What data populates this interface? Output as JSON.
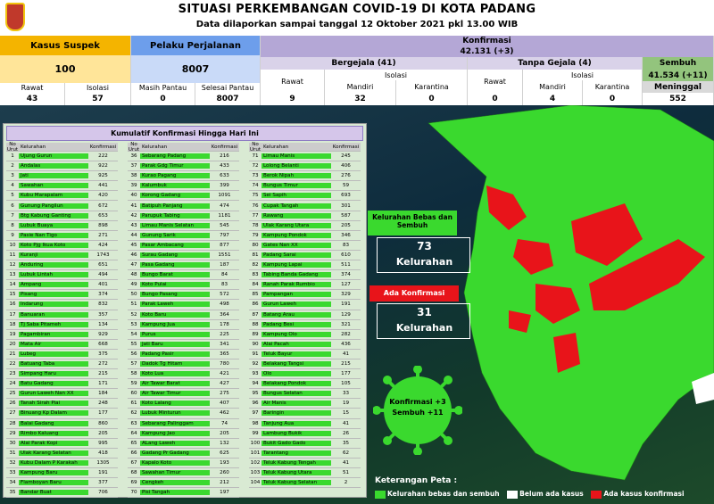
{
  "header": {
    "title": "SITUASI PERKEMBANGAN COVID-19 DI KOTA PADANG",
    "subtitle": "Data dilaporkan sampai tanggal 12 Oktober 2021 pkl 13.00 WIB"
  },
  "stats": {
    "kasus_suspek_label": "Kasus Suspek",
    "kasus_suspek_value": "100",
    "pelaku_label": "Pelaku Perjalanan",
    "pelaku_value": "8007",
    "konfirmasi_label": "Konfirmasi",
    "konfirmasi_value": "42.131 (+3)",
    "bergejala_label": "Bergejala (41)",
    "tanpa_gejala_label": "Tanpa Gejala (4)",
    "sembuh_label": "Sembuh",
    "sembuh_value": "41.534 (+11)",
    "meninggal_label": "Meninggal",
    "meninggal_value": "552",
    "rawat_label": "Rawat",
    "isolasi_label": "Isolasi",
    "masih_pantau_label": "Masih Pantau",
    "selesai_pantau_label": "Selesai Pantau",
    "mandiri_label": "Mandiri",
    "karantina_label": "Karantina",
    "suspek_rawat": "43",
    "suspek_isolasi": "57",
    "masih_pantau": "0",
    "selesai_pantau": "8007",
    "bergejala_rawat": "9",
    "bergejala_mandiri": "32",
    "bergejala_karantina": "0",
    "tanpa_rawat": "0",
    "tanpa_mandiri": "4",
    "tanpa_karantina": "0"
  },
  "table": {
    "title": "Kumulatif Konfirmasi Hingga Hari Ini",
    "headers": [
      "No Urut",
      "Kelurahan",
      "Konfirmasi"
    ],
    "rows": [
      [
        "1",
        "Ujung Gurun",
        "222"
      ],
      [
        "2",
        "Andalas",
        "922"
      ],
      [
        "3",
        "Jati",
        "925"
      ],
      [
        "4",
        "Sawahan",
        "441"
      ],
      [
        "5",
        "Kubu Marapalam",
        "420"
      ],
      [
        "6",
        "Gunung Pangilun",
        "672"
      ],
      [
        "7",
        "Btg Kabung Ganting",
        "653"
      ],
      [
        "8",
        "Lubuk Buaya",
        "898"
      ],
      [
        "9",
        "Pasie Nan Tigo",
        "271"
      ],
      [
        "10",
        "Koto Pjg Ikua Koto",
        "424"
      ],
      [
        "11",
        "Kuranji",
        "1743"
      ],
      [
        "12",
        "Anduring",
        "651"
      ],
      [
        "13",
        "Lubuk Lintah",
        "494"
      ],
      [
        "14",
        "Ampang",
        "401"
      ],
      [
        "15",
        "Pisang",
        "374"
      ],
      [
        "16",
        "Indarung",
        "832"
      ],
      [
        "17",
        "Banuaran",
        "357"
      ],
      [
        "18",
        "Tj Saba Pitameh",
        "134"
      ],
      [
        "19",
        "Pagambiran",
        "929"
      ],
      [
        "20",
        "Mata Air",
        "668"
      ],
      [
        "21",
        "Lubeg",
        "375"
      ],
      [
        "22",
        "Batuang Taba",
        "272"
      ],
      [
        "23",
        "Simpang Haru",
        "215"
      ],
      [
        "24",
        "Batu Gadang",
        "171"
      ],
      [
        "25",
        "Gurun Laweh Nan XX",
        "184"
      ],
      [
        "26",
        "Tanah Sirah Piai",
        "248"
      ],
      [
        "27",
        "Binuang Kp Dalam",
        "177"
      ],
      [
        "28",
        "Balai Gadang",
        "860"
      ],
      [
        "29",
        "Rimbo Kaluang",
        "205"
      ],
      [
        "30",
        "Alai Parak Kopi",
        "995"
      ],
      [
        "31",
        "Ulak Karang Selatan",
        "418"
      ],
      [
        "32",
        "Kubu Dalam P Karakah",
        "1305"
      ],
      [
        "33",
        "Kampung Baru",
        "191"
      ],
      [
        "34",
        "Flamboyan Baru",
        "377"
      ],
      [
        "35",
        "Bandar Buat",
        "706"
      ],
      [
        "36",
        "Sebarang Padang",
        "216"
      ],
      [
        "37",
        "Parak Gdg Timur",
        "433"
      ],
      [
        "38",
        "Kurao Pagang",
        "633"
      ],
      [
        "39",
        "Kalumbuk",
        "399"
      ],
      [
        "40",
        "Korong Gadang",
        "1091"
      ],
      [
        "41",
        "Batipuh Panjang",
        "474"
      ],
      [
        "42",
        "Parupuk Tabing",
        "1181"
      ],
      [
        "43",
        "Limau Manis Selatan",
        "545"
      ],
      [
        "44",
        "Gunung Sarik",
        "797"
      ],
      [
        "45",
        "Pasar Ambacang",
        "877"
      ],
      [
        "46",
        "Surau Gadang",
        "1551"
      ],
      [
        "47",
        "Pasa Gadang",
        "187"
      ],
      [
        "48",
        "Bungo Barat",
        "84"
      ],
      [
        "49",
        "Koto Pulai",
        "83"
      ],
      [
        "50",
        "Bungo Pasang",
        "572"
      ],
      [
        "51",
        "Parak Laweh",
        "498"
      ],
      [
        "52",
        "Koto Baru",
        "364"
      ],
      [
        "53",
        "Kampung Jua",
        "178"
      ],
      [
        "54",
        "Purus",
        "225"
      ],
      [
        "55",
        "Jati Baru",
        "341"
      ],
      [
        "56",
        "Padang Pasir",
        "365"
      ],
      [
        "57",
        "Dadok Tg Hitam",
        "780"
      ],
      [
        "58",
        "Koto Lua",
        "421"
      ],
      [
        "59",
        "Air Tawar Barat",
        "427"
      ],
      [
        "60",
        "Air Tawar Timur",
        "275"
      ],
      [
        "61",
        "Koto Lalang",
        "407"
      ],
      [
        "62",
        "Lubuk Minturun",
        "462"
      ],
      [
        "63",
        "Sebarang Palinggam",
        "74"
      ],
      [
        "64",
        "Kampung Jao",
        "205"
      ],
      [
        "65",
        "ALang Laweh",
        "132"
      ],
      [
        "66",
        "Gadang Pr Gadang",
        "625"
      ],
      [
        "67",
        "Kapalo Koto",
        "193"
      ],
      [
        "68",
        "Sawahan Timur",
        "260"
      ],
      [
        "69",
        "Cengkeh",
        "212"
      ],
      [
        "70",
        "Pisi Tangah",
        "197"
      ],
      [
        "71",
        "Limau Manis",
        "245"
      ],
      [
        "72",
        "Lolong Belanti",
        "406"
      ],
      [
        "73",
        "Berok Nipah",
        "276"
      ],
      [
        "74",
        "Bungus Timur",
        "59"
      ],
      [
        "75",
        "Sei Sapih",
        "693"
      ],
      [
        "76",
        "Cupak Tangah",
        "301"
      ],
      [
        "77",
        "Rawang",
        "587"
      ],
      [
        "78",
        "Ulak Karang Utara",
        "205"
      ],
      [
        "79",
        "Kampung Pondok",
        "346"
      ],
      [
        "80",
        "Gates Nan XX",
        "83"
      ],
      [
        "81",
        "Padang Sarai",
        "610"
      ],
      [
        "82",
        "Kampung Lapai",
        "511"
      ],
      [
        "83",
        "Tabing Banda Gadang",
        "374"
      ],
      [
        "84",
        "Ranah Parak Rumbio",
        "127"
      ],
      [
        "85",
        "Pampangan",
        "329"
      ],
      [
        "86",
        "Gurun Laweh",
        "191"
      ],
      [
        "87",
        "Batang Arau",
        "129"
      ],
      [
        "88",
        "Padang Besi",
        "321"
      ],
      [
        "89",
        "Kampung Olo",
        "282"
      ],
      [
        "90",
        "Alai Pacah",
        "436"
      ],
      [
        "91",
        "Teluk Bayur",
        "41"
      ],
      [
        "92",
        "Belakang Tangsi",
        "215"
      ],
      [
        "93",
        "Olo",
        "177"
      ],
      [
        "94",
        "Belakang Pondok",
        "105"
      ],
      [
        "95",
        "Bungus Selatan",
        "33"
      ],
      [
        "96",
        "Air Manis",
        "19"
      ],
      [
        "97",
        "Baringin",
        "15"
      ],
      [
        "98",
        "Tanjung Aua",
        "41"
      ],
      [
        "99",
        "Lambung Bukik",
        "26"
      ],
      [
        "100",
        "Bukit Gado Gado",
        "35"
      ],
      [
        "101",
        "Tarantang",
        "62"
      ],
      [
        "102",
        "Teluk Kabung Tengah",
        "41"
      ],
      [
        "103",
        "Teluk Kabung Utara",
        "51"
      ],
      [
        "104",
        "Teluk Kabung Selatan",
        "2"
      ]
    ]
  },
  "map_labels": {
    "bebas_title": "Kelurahan Bebas dan Sembuh",
    "bebas_count": "73",
    "bebas_unit": "Kelurahan",
    "ada_title": "Ada Konfirmasi",
    "ada_count": "31",
    "ada_unit": "Kelurahan",
    "virus_text_1": "Konfirmasi +3",
    "virus_text_2": "Sembuh +11"
  },
  "legend": {
    "title": "Keterangan Peta :",
    "items": [
      {
        "label": "Kelurahan bebas dan sembuh",
        "color": "#3ad92e"
      },
      {
        "label": "Belum ada kasus",
        "color": "#ffffff"
      },
      {
        "label": "Ada kasus konfirmasi",
        "color": "#e8141a"
      }
    ]
  },
  "colors": {
    "green": "#3ad92e",
    "red": "#e8141a",
    "suspek": "#f4b400",
    "pelaku": "#6d9eeb",
    "konfirmasi": "#b4a7d6",
    "sembuh": "#93c47d"
  }
}
